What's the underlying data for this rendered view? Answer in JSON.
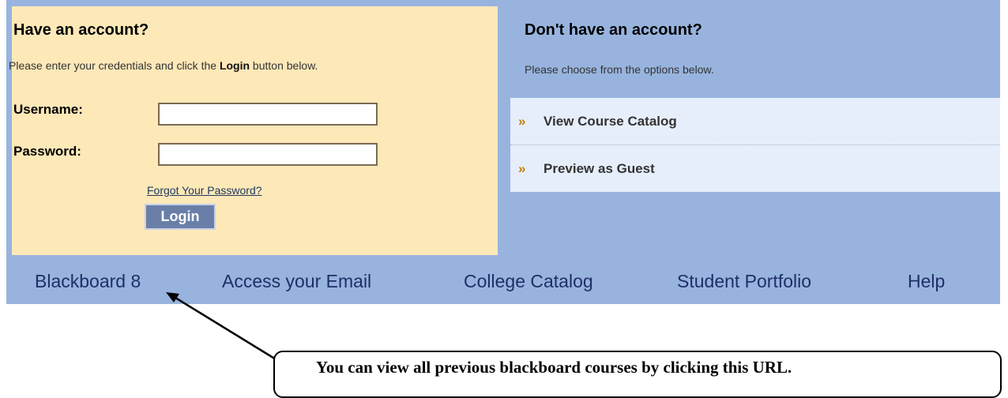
{
  "login": {
    "title": "Have an account?",
    "desc_pre": "Please enter your credentials and click the ",
    "desc_bold": "Login",
    "desc_post": " button below.",
    "username_label": "Username:",
    "username_value": "",
    "password_label": "Password:",
    "password_value": "",
    "forgot_link": "Forgot Your Password?",
    "login_button": "Login"
  },
  "no_account": {
    "title": "Don't have an account?",
    "desc": "Please choose from the options below.",
    "options": [
      {
        "icon": "double-chevron-right-icon",
        "glyph": "»",
        "label": "View Course Catalog"
      },
      {
        "icon": "double-chevron-right-icon",
        "glyph": "»",
        "label": "Preview as Guest"
      }
    ]
  },
  "nav": {
    "items": [
      {
        "label": "Blackboard 8"
      },
      {
        "label": "Access your Email"
      },
      {
        "label": "College Catalog"
      },
      {
        "label": "Student Portfolio"
      },
      {
        "label": "Help"
      }
    ]
  },
  "annotation": {
    "callout_text": "You can view all previous blackboard courses by clicking this URL."
  },
  "colors": {
    "panel_blue": "#98b4de",
    "login_panel_bg": "#fde8b8",
    "option_bg": "#e6eefb",
    "nav_link": "#1f2f66",
    "chevron": "#c77f00",
    "login_button_bg": "#6a7fa8"
  }
}
